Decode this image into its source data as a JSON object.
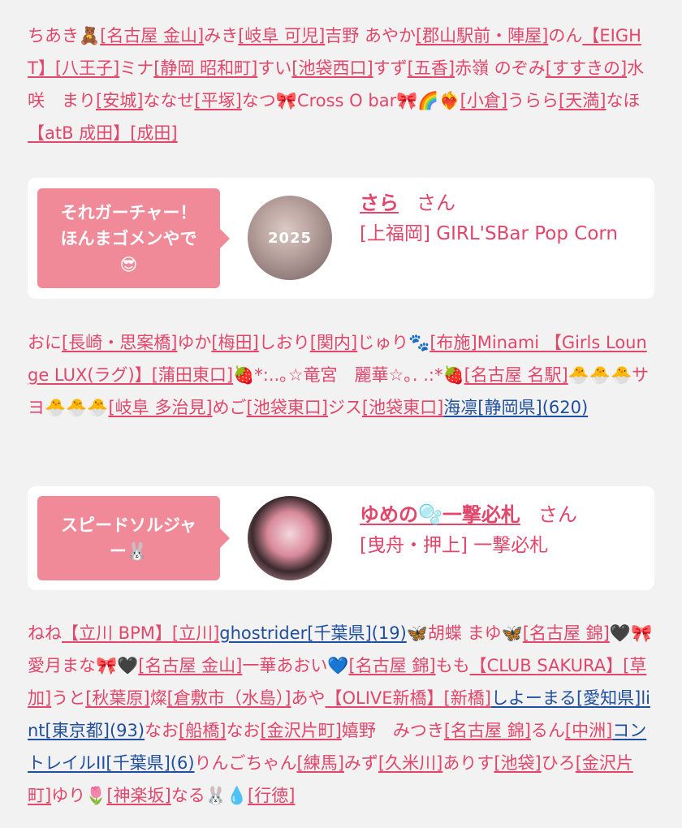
{
  "block1": [
    {
      "t": "ちあき🧸"
    },
    {
      "t": "[名古屋 金山]",
      "l": 1
    },
    {
      "t": "みき"
    },
    {
      "t": "[岐阜 可児]",
      "l": 1
    },
    {
      "t": "吉野 あやか"
    },
    {
      "t": "[郡山駅前・陣屋]",
      "l": 1
    },
    {
      "t": "のん"
    },
    {
      "t": "【EIGHT】",
      "l": 1
    },
    {
      "t": "[八王子]",
      "l": 1
    },
    {
      "t": "ミナ"
    },
    {
      "t": "[静岡 昭和町]",
      "l": 1
    },
    {
      "t": "すい"
    },
    {
      "t": "[池袋西口]",
      "l": 1
    },
    {
      "t": "すず"
    },
    {
      "t": "[五香]",
      "l": 1
    },
    {
      "t": "赤嶺 のぞみ"
    },
    {
      "t": "[すすきの]",
      "l": 1
    },
    {
      "t": "水咲　まり"
    },
    {
      "t": "[安城]",
      "l": 1
    },
    {
      "t": "ななせ"
    },
    {
      "t": "[平塚]",
      "l": 1
    },
    {
      "t": "なつ🎀Cross O bar🎀🌈❤️‍🔥"
    },
    {
      "t": "[小倉]",
      "l": 1
    },
    {
      "t": "うらら"
    },
    {
      "t": "[天満]",
      "l": 1
    },
    {
      "t": "なほ"
    },
    {
      "t": "【atB 成田】",
      "l": 1
    },
    {
      "t": "[成田]",
      "l": 1
    }
  ],
  "card1": {
    "bubble_line1": "それガーチャー！",
    "bubble_line2": "ほんまゴメンやで",
    "bubble_emoji": "😎",
    "avatar_text": "2025",
    "name": "さら",
    "suffix": "さん",
    "shop": "[上福岡] GIRL'SBar Pop Corn"
  },
  "block2": [
    {
      "t": "おに"
    },
    {
      "t": "[長崎・思案橋]",
      "l": 1
    },
    {
      "t": "ゆか"
    },
    {
      "t": "[梅田]",
      "l": 1
    },
    {
      "t": "しおり"
    },
    {
      "t": "[関内]",
      "l": 1
    },
    {
      "t": "じゅり🐾"
    },
    {
      "t": "[布施]",
      "l": 1
    },
    {
      "t": "Minami 【Girls Lounge LUX(ラグ)】",
      "l": 1
    },
    {
      "t": "[蒲田東口]",
      "l": 1
    },
    {
      "t": "🍓*:..｡☆竜宮　麗華☆｡. .:*🍓"
    },
    {
      "t": "[名古屋 名駅]",
      "l": 1
    },
    {
      "t": "🐣🐣🐣サヨ🐣🐣🐣"
    },
    {
      "t": "[岐阜 多治見]",
      "l": 1
    },
    {
      "t": "めご"
    },
    {
      "t": "[池袋東口]",
      "l": 1
    },
    {
      "t": "ジス"
    },
    {
      "t": "[池袋東口]",
      "l": 1
    },
    {
      "t": "海凛",
      "l": 2
    },
    {
      "t": "[静岡県]",
      "l": 2
    },
    {
      "t": "(620)",
      "l": 2
    }
  ],
  "card2": {
    "bubble_line1": "スピードソルジャ",
    "bubble_line2": "ー🐰",
    "name": "ゆめの🫧一撃必札",
    "suffix": "さん",
    "shop": "[曳舟・押上] 一撃必札"
  },
  "block3": [
    {
      "t": "ねね"
    },
    {
      "t": "【立川 BPM】",
      "l": 1
    },
    {
      "t": "[立川]",
      "l": 1
    },
    {
      "t": "ghostrider",
      "l": 2
    },
    {
      "t": "[千葉県]",
      "l": 2
    },
    {
      "t": "(19)",
      "l": 2
    },
    {
      "t": "🦋胡蝶 まゆ🦋"
    },
    {
      "t": "[名古屋 錦]",
      "l": 1
    },
    {
      "t": "🖤🎀愛月まな🎀🖤"
    },
    {
      "t": "[名古屋 金山]",
      "l": 1
    },
    {
      "t": "一華あおい💙"
    },
    {
      "t": "[名古屋 錦]",
      "l": 1
    },
    {
      "t": "もも"
    },
    {
      "t": "【CLUB SAKURA】",
      "l": 1
    },
    {
      "t": "[草加]",
      "l": 1
    },
    {
      "t": "うと"
    },
    {
      "t": "[秋葉原]",
      "l": 1
    },
    {
      "t": "燦"
    },
    {
      "t": "[倉敷市（水島）]",
      "l": 1
    },
    {
      "t": "あや"
    },
    {
      "t": "【OLIVE新橋】",
      "l": 1
    },
    {
      "t": "[新橋]",
      "l": 1
    },
    {
      "t": "しよーまる",
      "l": 2
    },
    {
      "t": "[愛知県]",
      "l": 2
    },
    {
      "t": "lint",
      "l": 2
    },
    {
      "t": "[東京都]",
      "l": 2
    },
    {
      "t": "(93)",
      "l": 2
    },
    {
      "t": "なお"
    },
    {
      "t": "[船橋]",
      "l": 1
    },
    {
      "t": "なお"
    },
    {
      "t": "[金沢片町]",
      "l": 1
    },
    {
      "t": "嬉野　みつき"
    },
    {
      "t": "[名古屋 錦]",
      "l": 1
    },
    {
      "t": "るん"
    },
    {
      "t": "[中洲]",
      "l": 1
    },
    {
      "t": "コントレイルII",
      "l": 2
    },
    {
      "t": "[千葉県]",
      "l": 2
    },
    {
      "t": "(6)",
      "l": 2
    },
    {
      "t": "りんごちゃん"
    },
    {
      "t": "[練馬]",
      "l": 1
    },
    {
      "t": "みず"
    },
    {
      "t": "[久米川]",
      "l": 1
    },
    {
      "t": "ありす"
    },
    {
      "t": "[池袋]",
      "l": 1
    },
    {
      "t": "ひろ"
    },
    {
      "t": "[金沢片町]",
      "l": 1
    },
    {
      "t": "ゆり🌷"
    },
    {
      "t": "[神楽坂]",
      "l": 1
    },
    {
      "t": "なる🐰💧"
    },
    {
      "t": "[行徳]",
      "l": 1
    }
  ]
}
